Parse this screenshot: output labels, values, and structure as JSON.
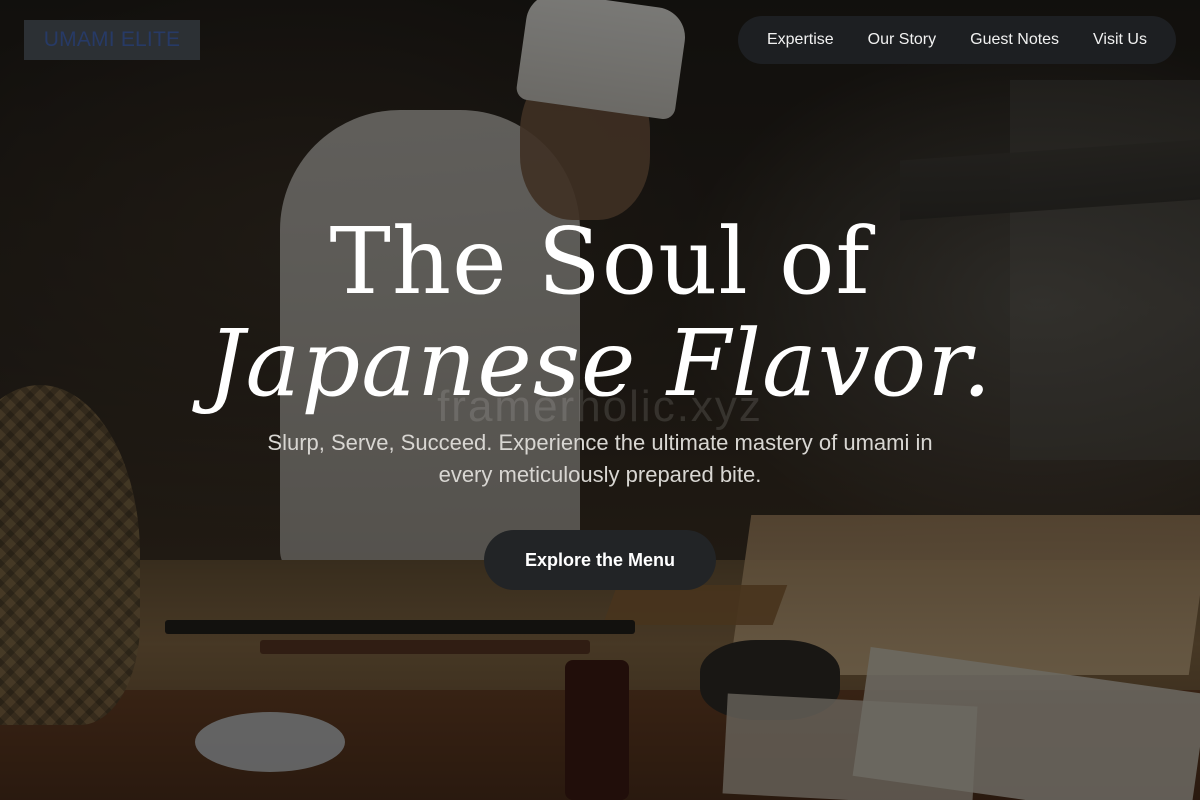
{
  "brand": {
    "name": "UMAMI ELITE"
  },
  "nav": {
    "links": [
      "Expertise",
      "Our Story",
      "Guest Notes",
      "Visit Us"
    ]
  },
  "hero": {
    "title_line1": "The Soul of",
    "title_line2": "Japanese Flavor.",
    "watermark": "framerholic.xyz",
    "subtitle": "Slurp, Serve, Succeed. Experience the ultimate mastery of umami in every meticulously prepared bite.",
    "cta_label": "Explore the Menu"
  },
  "colors": {
    "nav_bg": "#1d1f22",
    "cta_bg": "#222426",
    "text": "#ffffff"
  }
}
